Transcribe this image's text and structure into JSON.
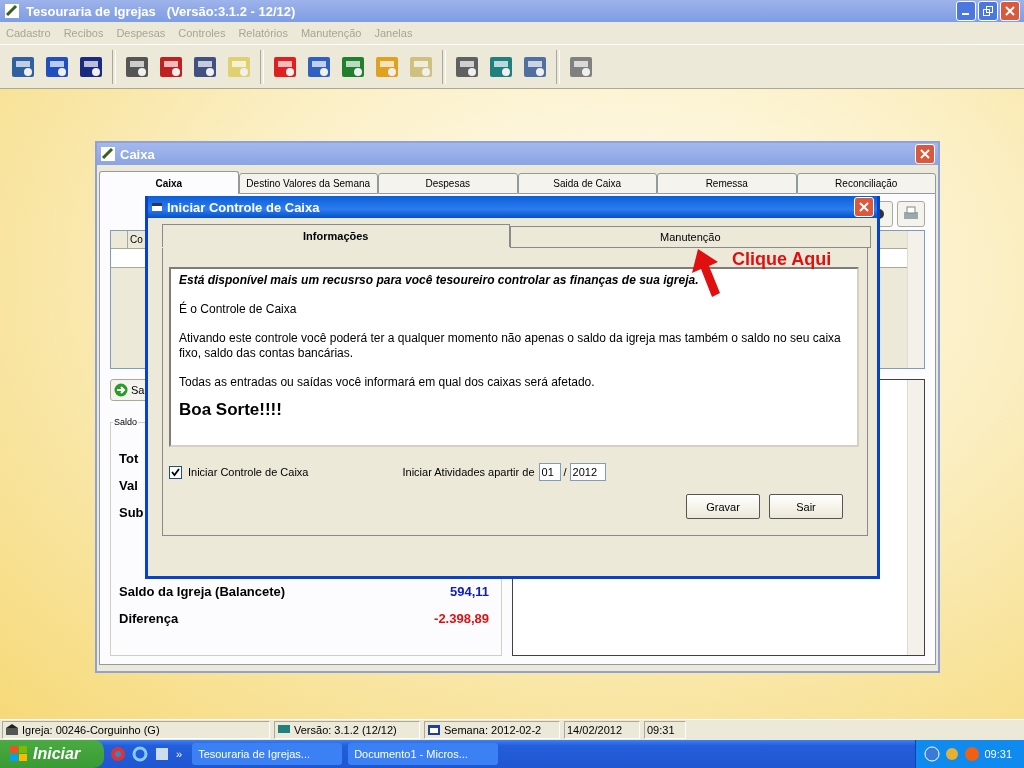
{
  "app_window": {
    "title": "Tesouraria de Igrejas",
    "version": "(Versão:3.1.2 - 12/12)"
  },
  "menu": [
    {
      "label": "Cadastro",
      "disabled": true
    },
    {
      "label": "Recibos",
      "disabled": true
    },
    {
      "label": "Despesas",
      "disabled": true
    },
    {
      "label": "Controles",
      "disabled": true
    },
    {
      "label": "Relatórios",
      "disabled": true
    },
    {
      "label": "Manutenção",
      "disabled": true
    },
    {
      "label": "Janelas",
      "disabled": true
    }
  ],
  "caixa_window": {
    "title": "Caixa",
    "tabs": [
      {
        "label": "Caixa",
        "selected": true
      },
      {
        "label": "Destino Valores da Semana",
        "selected": false
      },
      {
        "label": "Despesas",
        "selected": false
      },
      {
        "label": "Saida de Caixa",
        "selected": false
      },
      {
        "label": "Remessa",
        "selected": false
      },
      {
        "label": "Reconciliação",
        "selected": false
      }
    ],
    "grid_column": "Co",
    "button": "Sa",
    "group_label": "Saldo",
    "saldo_rows": [
      {
        "label": "Tot"
      },
      {
        "label": "Val"
      },
      {
        "label": "Sub"
      }
    ],
    "saldo_igreja": {
      "label": "Saldo da Igreja (Balancete)",
      "value": "594,11"
    },
    "diferenca": {
      "label": "Diferença",
      "value": "-2.398,89"
    }
  },
  "dialog": {
    "title": "Iniciar Controle de Caixa",
    "tabs": [
      {
        "label": "Informações",
        "selected": true
      },
      {
        "label": "Manutenção",
        "selected": false
      }
    ],
    "paragraphs": [
      {
        "kind": "lead",
        "text": "Está disponível mais um recusrso para você tesoureiro controlar as finanças de sua igreja."
      },
      {
        "kind": "normal",
        "text": "É o Controle de Caixa"
      },
      {
        "kind": "normal",
        "text": "Ativando este controle você poderá ter a qualquer momento não apenas o saldo da igreja mas também o saldo no seu caixa fixo, saldo das contas bancárias."
      },
      {
        "kind": "normal",
        "text": "Todas as entradas ou saídas você informará em qual dos caixas será afetado."
      },
      {
        "kind": "big",
        "text": "Boa Sorte!!!!"
      }
    ],
    "checkbox": {
      "label": "Iniciar Controle de Caixa",
      "checked": true
    },
    "start_label": "Iniciar Atividades apartir de",
    "month": "01",
    "separator": "/",
    "year": "2012",
    "buttons": [
      "Gravar",
      "Sair"
    ]
  },
  "annotation": "Clique Aqui",
  "status_bar": {
    "igreja": "Igreja: 00246-Corguinho (G)",
    "versao": "Versão: 3.1.2 (12/12)",
    "semana": "Semana: 2012-02-2",
    "date": "14/02/2012",
    "time": "09:31"
  },
  "taskbar": {
    "start": "Iniciar",
    "chevron": "»",
    "tasks": [
      {
        "label": "Tesouraria de Igrejas...",
        "selected": false
      },
      {
        "label": "Documento1 - Micros...",
        "selected": false
      }
    ],
    "clock": "09:31"
  }
}
